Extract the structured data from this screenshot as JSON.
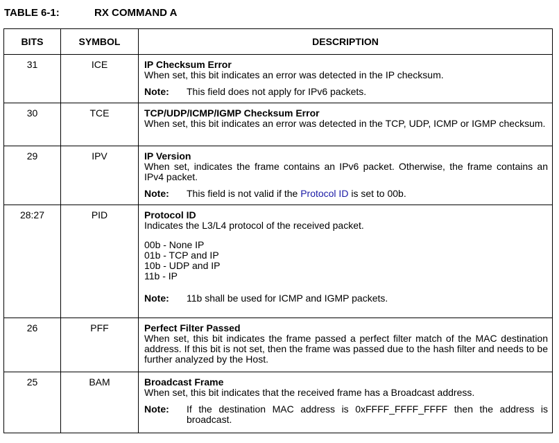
{
  "table_title": {
    "number": "TABLE 6-1:",
    "name": "RX COMMAND A"
  },
  "headers": {
    "bits": "BITS",
    "symbol": "SYMBOL",
    "description": "DESCRIPTION"
  },
  "note_label": "Note:",
  "rows": [
    {
      "bits": "31",
      "symbol": "ICE",
      "title": "IP Checksum Error",
      "text": "When set, this bit indicates an error was detected in the IP checksum.",
      "note": "This field does not apply for IPv6 packets."
    },
    {
      "bits": "30",
      "symbol": "TCE",
      "title": "TCP/UDP/ICMP/IGMP Checksum Error",
      "text": "When set, this bit indicates an error was detected in the TCP, UDP, ICMP or IGMP checksum."
    },
    {
      "bits": "29",
      "symbol": "IPV",
      "title": "IP Version",
      "text": "When set, indicates the frame contains an IPv6 packet. Otherwise, the frame contains an IPv4 packet.",
      "note_pre": "This field is not valid if the ",
      "note_link": "Protocol ID",
      "note_post": " is set to 00b."
    },
    {
      "bits": "28:27",
      "symbol": "PID",
      "title": "Protocol ID",
      "text": "Indicates the L3/L4 protocol of the received packet.",
      "codes": [
        "00b - None IP",
        "01b - TCP and IP",
        "10b - UDP and IP",
        "11b - IP"
      ],
      "note": "11b shall be used for ICMP and IGMP packets."
    },
    {
      "bits": "26",
      "symbol": "PFF",
      "title": "Perfect Filter Passed",
      "text": "When set, this bit indicates the frame passed a perfect filter match of the MAC destination address. If this bit is not set, then the frame was passed due to the hash filter and needs to be further analyzed by the Host."
    },
    {
      "bits": "25",
      "symbol": "BAM",
      "title": "Broadcast Frame",
      "text": "When set, this bit indicates that the received frame has a Broadcast address.",
      "note": "If the destination MAC address is 0xFFFF_FFFF_FFFF then the address is broadcast."
    }
  ]
}
